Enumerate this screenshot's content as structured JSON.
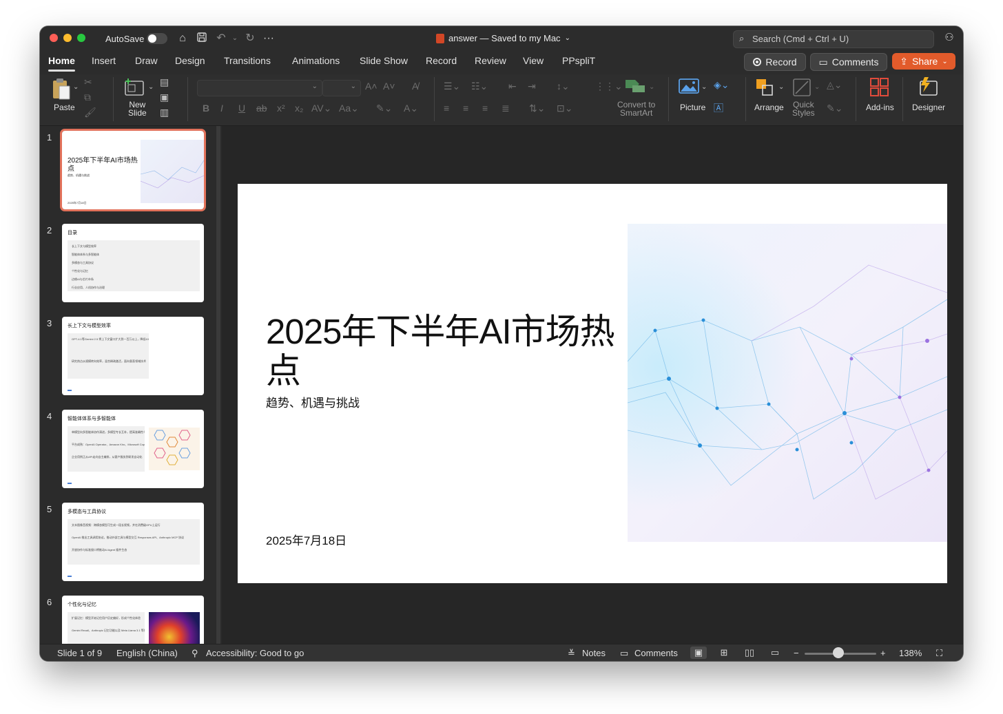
{
  "titlebar": {
    "autosave_label": "AutoSave",
    "doc_title": "answer — Saved to my Mac",
    "search_placeholder": "Search (Cmd + Ctrl + U)"
  },
  "tabs": [
    "Home",
    "Insert",
    "Draw",
    "Design",
    "Transitions",
    "Animations",
    "Slide Show",
    "Record",
    "Review",
    "View",
    "PPspliT"
  ],
  "tab_actions": {
    "record": "Record",
    "comments": "Comments",
    "share": "Share"
  },
  "ribbon": {
    "paste": "Paste",
    "new_slide": [
      "New",
      "Slide"
    ],
    "convert_smartart": [
      "Convert to",
      "SmartArt"
    ],
    "picture": "Picture",
    "arrange": "Arrange",
    "quick_styles": [
      "Quick",
      "Styles"
    ],
    "add_ins": "Add-ins",
    "designer": "Designer"
  },
  "thumbnails": [
    {
      "num": "1",
      "title": "2025年下半年AI市场热点",
      "subtitle": "趋势、机遇与挑战",
      "date": "2025年7月18日"
    },
    {
      "num": "2",
      "title": "目录",
      "lines": [
        "长上下文与模型效率",
        "智能体体系与多智能体",
        "多模态与工具协议",
        "个性化与记忆",
        "边缘AI与芯片市场",
        "行业应用、人机协作与治理"
      ]
    },
    {
      "num": "3",
      "title": "长上下文与模型效率",
      "lines": [
        "GPT-4.1等Gemini 2.5 将上下文窗口扩大到一百万以上，降低100倍成本",
        "研究热点从规模转向效率，混合稀疏激活，面向垂直领域技术"
      ]
    },
    {
      "num": "4",
      "title": "智能体体系与多智能体",
      "lines": [
        "单模型向多智能体协作演进，多模型专长互补，提高准确性与扩展力",
        "平台成熟：OpenAI Operator、Amazon Kiro、Microsoft Copilot Studio 为代理提供操作平台",
        "企业用例正从API走向自主编排，从客户服务到研发自动化"
      ]
    },
    {
      "num": "5",
      "title": "多模态与工具协议",
      "lines": [
        "文本图像音视频：跨模态模型可生成一段长视频，并在消费级GPU上运行",
        "OpenAI 推出工具调用协议，推动外部工具与模型交互 Responses API、Anthropic MCP 协议",
        "开放协作与标准接口将推动AI Agent 插件生态"
      ]
    },
    {
      "num": "6",
      "title": "个性化与记忆",
      "lines": [
        "扩展记忆：模型开始记住用户历史偏好，形成个性化体验",
        "Gemini Recall、Anthropic 记忆功能以及 Meta Llama 3.1 等持续学习"
      ]
    }
  ],
  "slide": {
    "title": "2025年下半年AI市场热点",
    "subtitle": "趋势、机遇与挑战",
    "date": "2025年7月18日"
  },
  "statusbar": {
    "slide_of": "Slide 1 of 9",
    "language": "English (China)",
    "accessibility": "Accessibility: Good to go",
    "notes": "Notes",
    "comments": "Comments",
    "zoom": "138%",
    "zoom_level": 0.47
  }
}
